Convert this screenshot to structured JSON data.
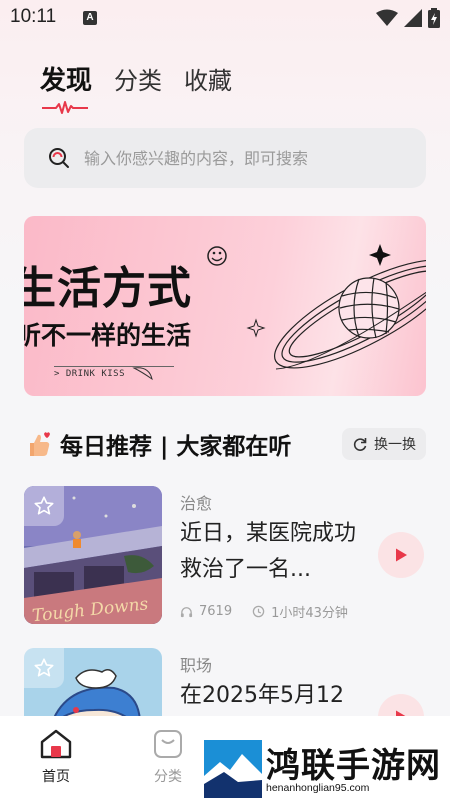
{
  "status_bar": {
    "time": "10:11",
    "notif_letter": "A"
  },
  "top_tabs": [
    {
      "label": "发现",
      "active": true
    },
    {
      "label": "分类",
      "active": false
    },
    {
      "label": "收藏",
      "active": false
    }
  ],
  "search": {
    "placeholder": "输入你感兴趣的内容，即可搜索"
  },
  "banner": {
    "title": "生活方式",
    "subtitle": "听不一样的生活",
    "tag": "> DRINK KISS"
  },
  "section": {
    "title": "每日推荐 | 大家都在听",
    "refresh_label": "换一换"
  },
  "items": [
    {
      "category": "治愈",
      "title": "近日，某医院成功救治了一名...",
      "plays": "7619",
      "duration": "1小时43分钟",
      "cover_text": "Tough Downs"
    },
    {
      "category": "职场",
      "title": "在2025年5月12"
    }
  ],
  "bottom_nav": [
    {
      "label": "首页",
      "active": true
    },
    {
      "label": "分类",
      "active": false
    }
  ],
  "watermark": {
    "text": "鸿联手游网",
    "url": "henanhonglian95.com"
  },
  "colors": {
    "accent": "#e8384a",
    "play_bg": "#fbe3e5",
    "search_bg": "#ececee"
  }
}
